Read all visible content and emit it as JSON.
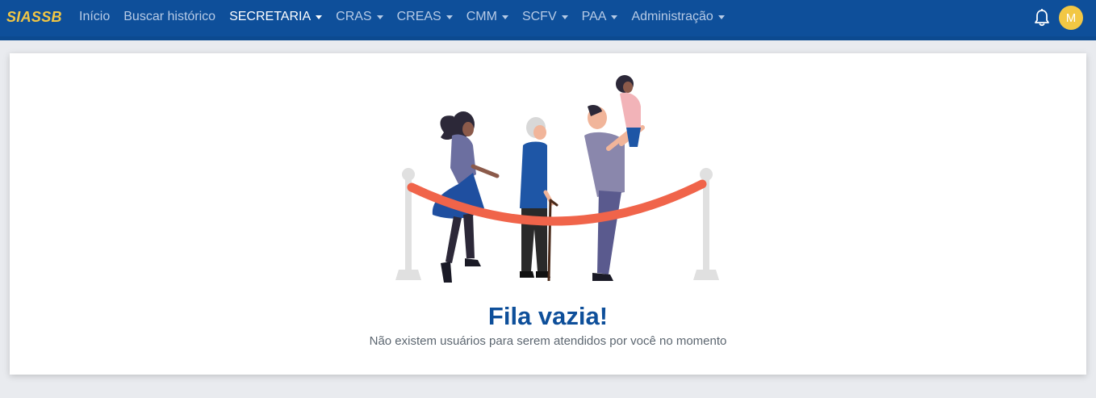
{
  "brand": {
    "name": "SIASSB",
    "color": "#f2c744"
  },
  "nav": {
    "items": [
      {
        "label": "Início",
        "dropdown": false,
        "active": false
      },
      {
        "label": "Buscar histórico",
        "dropdown": false,
        "active": false
      },
      {
        "label": "SECRETARIA",
        "dropdown": true,
        "active": true
      },
      {
        "label": "CRAS",
        "dropdown": true,
        "active": false
      },
      {
        "label": "CREAS",
        "dropdown": true,
        "active": false
      },
      {
        "label": "CMM",
        "dropdown": true,
        "active": false
      },
      {
        "label": "SCFV",
        "dropdown": true,
        "active": false
      },
      {
        "label": "PAA",
        "dropdown": true,
        "active": false
      },
      {
        "label": "Administração",
        "dropdown": true,
        "active": false
      }
    ]
  },
  "user": {
    "avatar_initial": "M",
    "notification_icon": "bell-icon"
  },
  "empty_state": {
    "title": "Fila vazia!",
    "message": "Não existem usuários para serem atendidos por você no momento",
    "illustration": "people-waiting-behind-rope-barrier"
  },
  "colors": {
    "navbar": "#0e4f9a",
    "accent": "#f2c744",
    "rope": "#f0644a"
  }
}
